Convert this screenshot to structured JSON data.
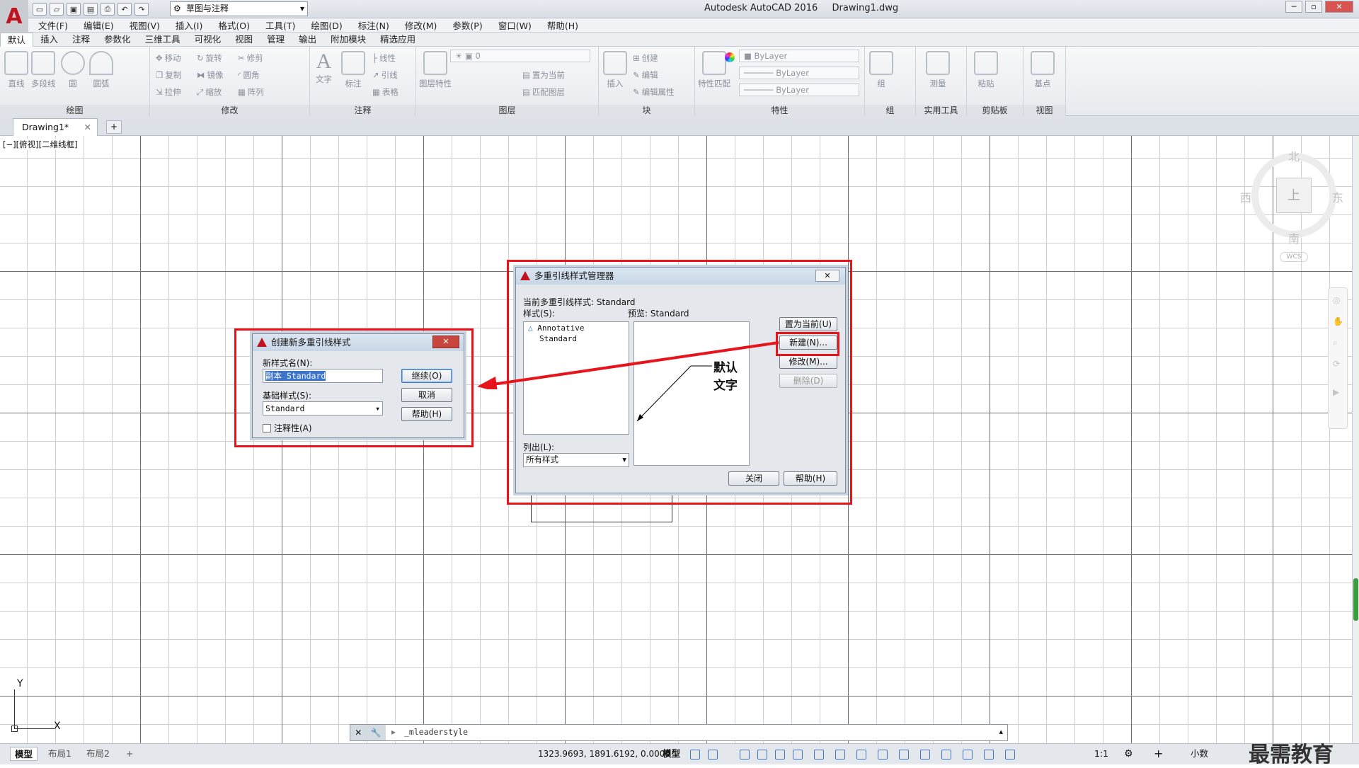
{
  "app": {
    "title": "Autodesk AutoCAD 2016",
    "file": "Drawing1.dwg",
    "workspace": "草图与注释"
  },
  "menu": [
    "文件(F)",
    "编辑(E)",
    "视图(V)",
    "插入(I)",
    "格式(O)",
    "工具(T)",
    "绘图(D)",
    "标注(N)",
    "修改(M)",
    "参数(P)",
    "窗口(W)",
    "帮助(H)"
  ],
  "ribbon_tabs": [
    "默认",
    "插入",
    "注释",
    "参数化",
    "三维工具",
    "可视化",
    "视图",
    "管理",
    "输出",
    "附加模块",
    "精选应用"
  ],
  "ribbon": {
    "draw": {
      "title": "绘图",
      "line": "直线",
      "polyline": "多段线",
      "circle": "圆",
      "arc": "圆弧"
    },
    "modify": {
      "title": "修改",
      "move": "移动",
      "rotate": "旋转",
      "trim": "修剪",
      "copy": "复制",
      "mirror": "镜像",
      "fillet": "圆角",
      "stretch": "拉伸",
      "scale": "缩放",
      "array": "阵列"
    },
    "annotation": {
      "title": "注释",
      "text": "文字",
      "dim": "标注",
      "linear": "线性",
      "leader": "引线",
      "table": "表格"
    },
    "layers": {
      "title": "图层",
      "props": "图层特性",
      "current_layer": "0",
      "set_current": "置为当前",
      "match": "匹配图层"
    },
    "block": {
      "title": "块",
      "insert": "插入",
      "create": "创建",
      "edit": "编辑",
      "edit_attr": "编辑属性"
    },
    "properties": {
      "title": "特性",
      "match": "特性匹配",
      "color": "ByLayer",
      "linetype": "ByLayer",
      "lineweight": "ByLayer"
    },
    "groups": {
      "title": "组",
      "group": "组"
    },
    "utilities": {
      "title": "实用工具",
      "measure": "测量"
    },
    "clipboard": {
      "title": "剪贴板",
      "paste": "粘贴"
    },
    "view": {
      "title": "视图",
      "base": "基点"
    }
  },
  "doc_tab": "Drawing1*",
  "viewport_label": "[−][俯视][二维线框]",
  "viewcube": {
    "north": "北",
    "south": "南",
    "east": "东",
    "west": "西",
    "top": "上",
    "wcs": "WCS"
  },
  "ucs": {
    "x": "X",
    "y": "Y"
  },
  "mleader_manager": {
    "title": "多重引线样式管理器",
    "current_label": "当前多重引线样式: Standard",
    "styles_label": "样式(S):",
    "styles": [
      "Annotative",
      "Standard"
    ],
    "preview_label": "预览: Standard",
    "list_label": "列出(L):",
    "list_value": "所有样式",
    "set_current": "置为当前(U)",
    "new": "新建(N)...",
    "modify": "修改(M)...",
    "delete": "删除(D)",
    "close": "关闭",
    "help": "帮助(H)",
    "preview_text": "默认文字"
  },
  "create_dialog": {
    "title": "创建新多重引线样式",
    "new_name_label": "新样式名(N):",
    "new_name_value": "副本 Standard",
    "base_label": "基础样式(S):",
    "base_value": "Standard",
    "annotative_label": "注释性(A)",
    "continue": "继续(O)",
    "cancel": "取消",
    "help": "帮助(H)"
  },
  "command_line": "_mleaderstyle",
  "status": {
    "coords": "1323.9693, 1891.6192, 0.0000",
    "model": "模型",
    "scale": "1:1",
    "units": "小数"
  },
  "layout_tabs": [
    "模型",
    "布局1",
    "布局2"
  ],
  "watermark": "最需教育"
}
